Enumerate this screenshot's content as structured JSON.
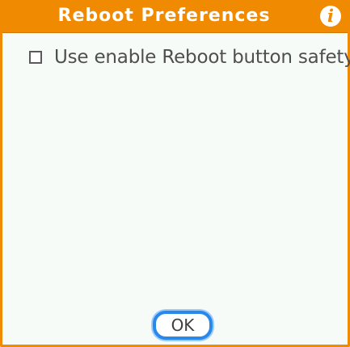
{
  "dialog": {
    "title": "Reboot Preferences",
    "info_icon": "info-icon",
    "options": [
      {
        "label": "Use enable Reboot button safety",
        "checked": false
      }
    ],
    "ok_label": "OK"
  },
  "colors": {
    "title_bar": "#f08a00",
    "border": "#f08a00",
    "background": "#f6fbf8",
    "ok_border": "#2a88e8"
  }
}
